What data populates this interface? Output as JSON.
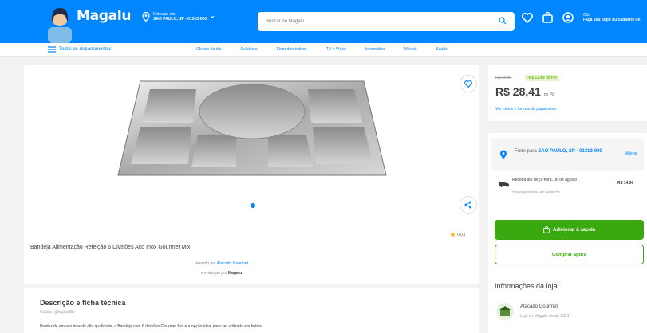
{
  "header": {
    "logo": "Magalu",
    "location_label": "Entregar em",
    "location_value": "SAO PAULO, SP - 01313-000",
    "search_placeholder": "Buscar no Magalu",
    "user_greeting": "Olá",
    "user_action": "Faça seu login ou cadastre-se",
    "brand_color": "#0086ff"
  },
  "nav": {
    "all_label": "Todos os departamentos",
    "items": [
      "Ofertas do dia",
      "Celulares",
      "Eletrodomésticos",
      "TV e Vídeo",
      "Informática",
      "Móveis",
      "Saúde"
    ]
  },
  "product": {
    "title": "Bandeja Alimentação Refeição 6 Divisões Aço Inox Gourmet Mix",
    "rating": "0 (0)",
    "sold_by_label": "Vendido por",
    "sold_by_value": "Atacado Gourmet",
    "delivered_by_label": "e entregue por",
    "delivered_by_value": "Magalu"
  },
  "price": {
    "old": "R$ 39,90",
    "discount": "-R$ 11,49 no Pix",
    "value": "R$ 28,41",
    "suffix": "no Pix",
    "payment_link": "Ver meios e formas de pagamento"
  },
  "shipping": {
    "label": "Frete para",
    "location": "SAO PAULO, SP - 01313-000",
    "change": "Alterar",
    "delivery": "Receba até terça-feira, 08 de agosto",
    "delivery_sub": "Para pagamentos com Cartão/Pix",
    "delivery_price": "R$ 14,90"
  },
  "buttons": {
    "add_to_cart": "Adicionar à sacola",
    "buy_now": "Comprar agora"
  },
  "description": {
    "heading": "Descrição e ficha técnica",
    "code": "Código: jj3eg9ad0h",
    "text": "Produzida em aço inox de alta qualidade, a Bandeja com 6 divisões Gourmet Mix é a opção ideal para ser utilizada em hotéis,"
  },
  "store": {
    "heading": "Informações da loja",
    "name": "Atacado Gourmet",
    "since": "Loja no Magalu desde 2021"
  }
}
